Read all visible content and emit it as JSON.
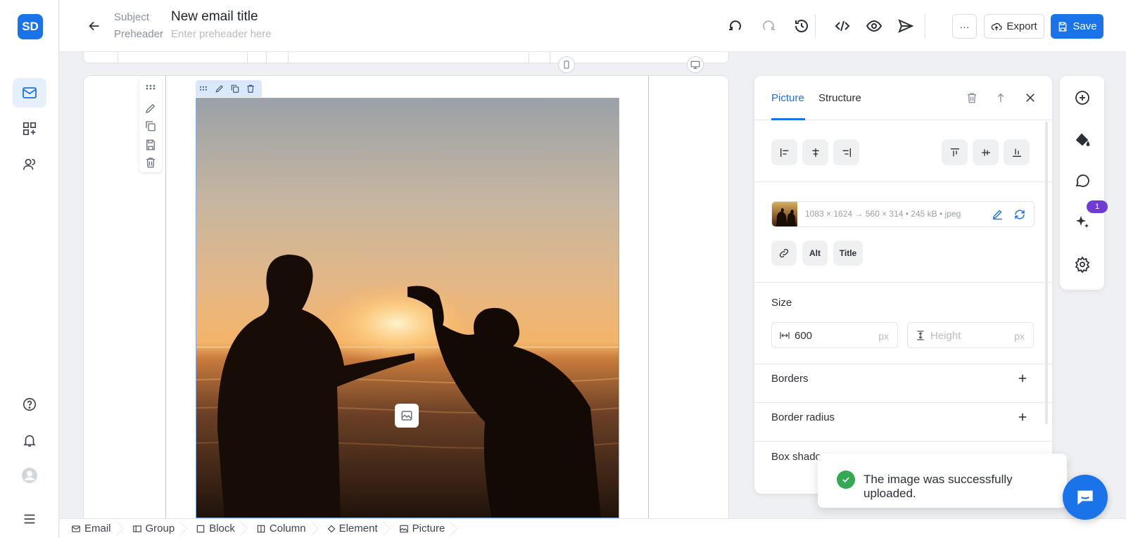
{
  "sidebar": {
    "logo": "SD",
    "items": [
      {
        "icon": "envelope-icon",
        "active": true
      },
      {
        "icon": "grid-plus-icon",
        "active": false
      },
      {
        "icon": "users-icon",
        "active": false
      }
    ],
    "bottom": [
      {
        "icon": "help-icon"
      },
      {
        "icon": "bell-icon"
      },
      {
        "icon": "avatar-icon"
      },
      {
        "icon": "menu-icon"
      }
    ]
  },
  "header": {
    "subject_label": "Subject",
    "subject_value": "New email title",
    "preheader_label": "Preheader",
    "preheader_placeholder": "Enter preheader here",
    "more_label": "···",
    "export_label": "Export",
    "save_label": "Save",
    "accent": "#1a73e8"
  },
  "breadcrumbs": [
    "Email",
    "Group",
    "Block",
    "Column",
    "Element",
    "Picture"
  ],
  "panel": {
    "tabs": [
      {
        "label": "Picture",
        "active": true
      },
      {
        "label": "Structure",
        "active": false
      }
    ],
    "image_meta": "1083 × 1624 → 560 × 314  •  245 kB  •  jpeg",
    "link_labels": {
      "alt": "Alt",
      "title": "Title"
    },
    "size": {
      "label": "Size",
      "width_value": "600",
      "width_unit": "px",
      "height_placeholder": "Height",
      "height_unit": "px"
    },
    "sections": [
      "Borders",
      "Border radius",
      "Box shadow"
    ]
  },
  "right_toolbar": {
    "icons": [
      "add-circle-icon",
      "paint-bucket-icon",
      "chat-icon",
      "sparkles-icon",
      "gear-icon"
    ],
    "badge": "1",
    "badge_color": "#6f3bd4"
  },
  "toast": {
    "message": "The image was successfully uploaded.",
    "color": "#34a853"
  }
}
